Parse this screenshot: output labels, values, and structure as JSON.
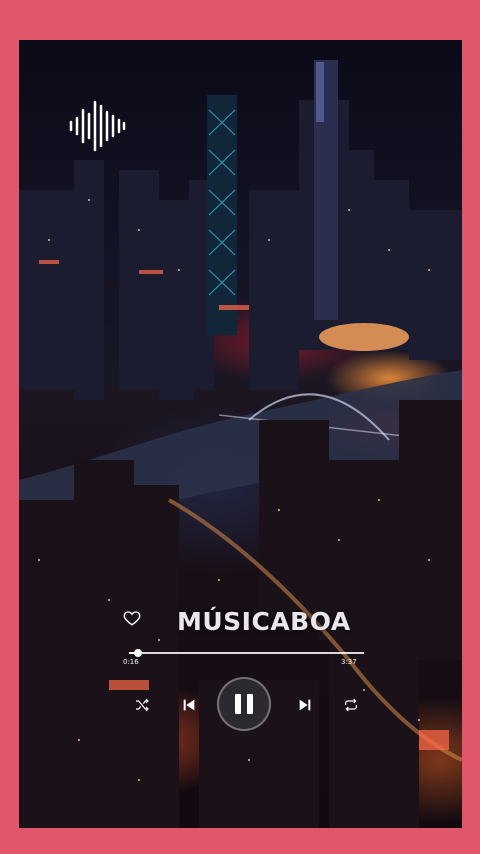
{
  "app": {
    "brand_color": "#e0566a"
  },
  "logo": {
    "icon": "soundwave-icon"
  },
  "player": {
    "title": "MÚSICABOA",
    "elapsed": "0:16",
    "total": "3:37",
    "progress": 0.04,
    "state": "playing"
  },
  "icons": {
    "favorite": "heart-outline-icon",
    "shuffle": "shuffle-icon",
    "previous": "skip-previous-icon",
    "pause": "pause-icon",
    "next": "skip-next-icon",
    "repeat": "repeat-icon"
  }
}
